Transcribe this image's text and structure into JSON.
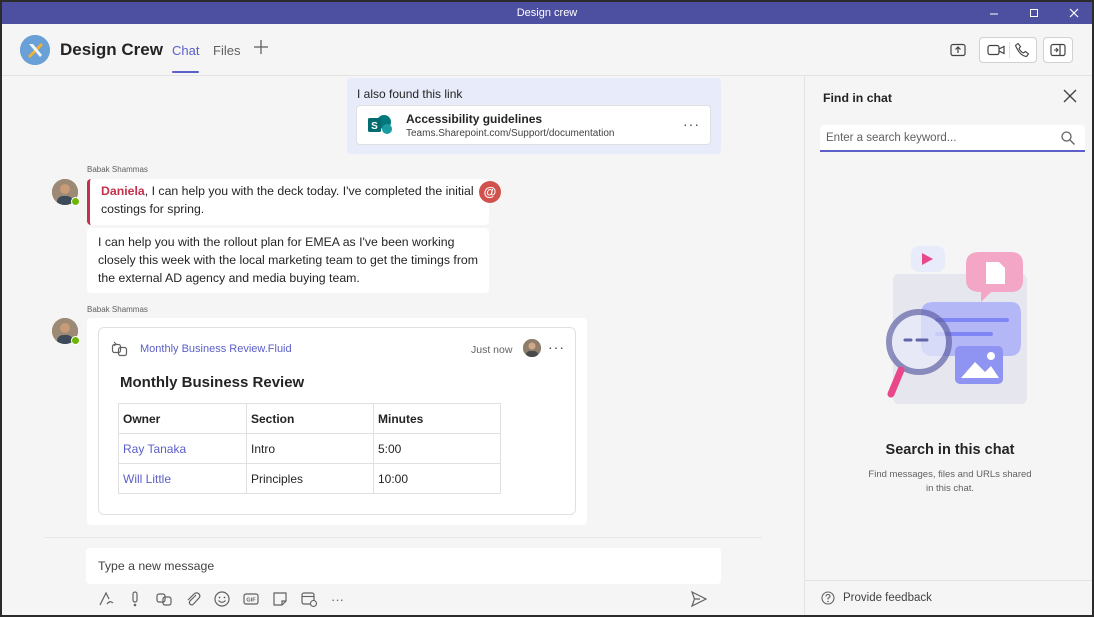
{
  "window": {
    "title": "Design crew"
  },
  "header": {
    "chat_name": "Design Crew",
    "tabs": [
      {
        "label": "Chat",
        "active": true
      },
      {
        "label": "Files",
        "active": false
      }
    ],
    "add_tab_icon": "plus-icon",
    "accent_color": "#5b5fc7"
  },
  "messages": {
    "link_message": {
      "text": "I also found this link",
      "link_title": "Accessibility guidelines",
      "link_url": "Teams.Sharepoint.com/Support/documentation",
      "more": "···"
    },
    "group1": {
      "sender": "Babak Shammas",
      "mention": "Daniela",
      "message1_rest": ", I can help you with the deck today. I've completed the initial costings for spring.",
      "message2": "I can help you with the rollout plan for EMEA as I've been working closely this week with the local marketing team to get the timings from the external AD agency and media buying team.",
      "at_badge": "@"
    },
    "group2": {
      "sender": "Babak Shammas",
      "fluid": {
        "file_name": "Monthly Business Review.Fluid",
        "time": "Just now",
        "more": "···",
        "title": "Monthly Business Review",
        "columns": [
          "Owner",
          "Section",
          "Minutes"
        ],
        "rows": [
          [
            "Ray Tanaka",
            "Intro",
            "5:00"
          ],
          [
            "Will Little",
            "Principles",
            "10:00"
          ]
        ]
      }
    }
  },
  "compose": {
    "placeholder": "Type a new message",
    "toolbar_icons": [
      "format-icon",
      "priority-icon",
      "loop-icon",
      "attach-icon",
      "emoji-icon",
      "gif-icon",
      "sticker-icon",
      "schedule-meeting-icon",
      "more-icon"
    ],
    "more": "···"
  },
  "find_panel": {
    "title": "Find in chat",
    "search_placeholder": "Enter a search keyword...",
    "heading": "Search in this chat",
    "subtext": "Find messages, files and URLs shared in this chat.",
    "feedback": "Provide feedback"
  }
}
